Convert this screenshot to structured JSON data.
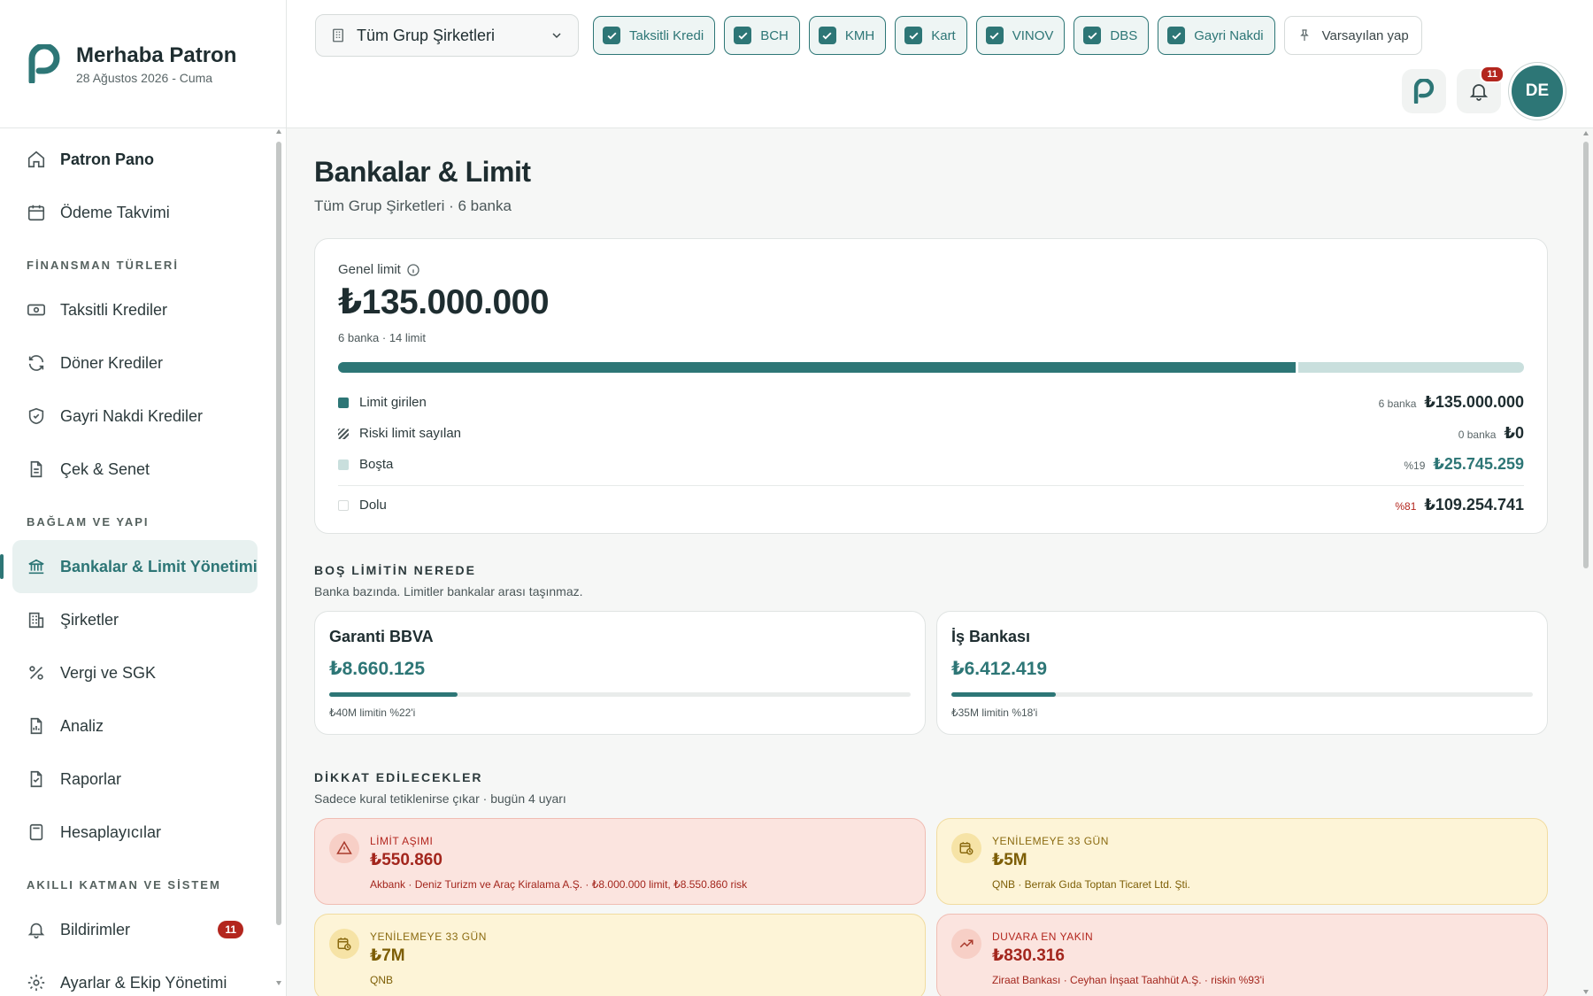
{
  "brand": {
    "name": "Merhaba Patron",
    "date": "28 Ağustos 2026 - Cuma"
  },
  "sidebar": {
    "top_items": [
      {
        "label": "Patron Pano",
        "icon": "home-icon"
      },
      {
        "label": "Ödeme Takvimi",
        "icon": "calendar-icon"
      }
    ],
    "sections": [
      {
        "title": "FİNANSMAN TÜRLERİ",
        "items": [
          {
            "label": "Taksitli Krediler",
            "icon": "banknote-icon"
          },
          {
            "label": "Döner Krediler",
            "icon": "refresh-icon"
          },
          {
            "label": "Gayri Nakdi Krediler",
            "icon": "shield-check-icon"
          },
          {
            "label": "Çek & Senet",
            "icon": "document-icon"
          }
        ]
      },
      {
        "title": "BAĞLAM VE YAPI",
        "items": [
          {
            "label": "Bankalar & Limit Yönetimi",
            "icon": "bank-icon",
            "active": true
          },
          {
            "label": "Şirketler",
            "icon": "building-icon"
          },
          {
            "label": "Vergi ve SGK",
            "icon": "percent-icon"
          },
          {
            "label": "Analiz",
            "icon": "chart-file-icon"
          },
          {
            "label": "Raporlar",
            "icon": "report-file-icon"
          },
          {
            "label": "Hesaplayıcılar",
            "icon": "calculator-icon"
          }
        ]
      },
      {
        "title": "AKILLI KATMAN VE SİSTEM",
        "items": [
          {
            "label": "Bildirimler",
            "icon": "bell-icon",
            "badge": "11"
          },
          {
            "label": "Ayarlar & Ekip Yönetimi",
            "icon": "gear-icon"
          }
        ]
      }
    ]
  },
  "topbar": {
    "company_select": "Tüm Grup Şirketleri",
    "filters": [
      "Taksitli Kredi",
      "BCH",
      "KMH",
      "Kart",
      "VINOV",
      "DBS",
      "Gayri Nakdi"
    ],
    "default_button": "Varsayılan yap",
    "notification_count": "11",
    "avatar_initials": "DE"
  },
  "page": {
    "title": "Bankalar & Limit",
    "subtitle": "Tüm Grup Şirketleri · 6 banka"
  },
  "overview": {
    "label": "Genel limit",
    "total": "₺135.000.000",
    "meta": "6 banka · 14 limit",
    "used_fraction": 0.81,
    "legend": [
      {
        "label": "Limit girilen",
        "note": "6 banka",
        "amount": "₺135.000.000"
      },
      {
        "label": "Riski limit sayılan",
        "note": "0 banka",
        "amount": "₺0"
      },
      {
        "label": "Boşta",
        "note": "%19",
        "amount": "₺25.745.259"
      },
      {
        "label": "Dolu",
        "note": "%81",
        "amount": "₺109.254.741"
      }
    ]
  },
  "free_limit": {
    "title": "BOŞ LİMİTİN NEREDE",
    "subtitle": "Banka bazında. Limitler bankalar arası taşınmaz.",
    "banks": [
      {
        "name": "Garanti BBVA",
        "amount": "₺8.660.125",
        "fraction": 0.22,
        "meta": "₺40M limitin %22'i"
      },
      {
        "name": "İş Bankası",
        "amount": "₺6.412.419",
        "fraction": 0.18,
        "meta": "₺35M limitin %18'i"
      }
    ]
  },
  "attention": {
    "title": "DİKKAT EDİLECEKLER",
    "subtitle": "Sadece kural tetiklenirse çıkar · bugün 4 uyarı",
    "alerts": [
      {
        "kicker": "LİMİT AŞIMI",
        "amount": "₺550.860",
        "desc": "Akbank · Deniz Turizm ve Araç Kiralama A.Ş. · ₺8.000.000 limit, ₺8.550.860 risk",
        "tone": "red",
        "icon": "warning-icon"
      },
      {
        "kicker": "YENİLEMEYE 33 GÜN",
        "amount": "₺5M",
        "desc": "QNB · Berrak Gıda Toptan Ticaret Ltd. Şti.",
        "tone": "yellow",
        "icon": "calendar-clock-icon"
      },
      {
        "kicker": "YENİLEMEYE 33 GÜN",
        "amount": "₺7M",
        "desc": "QNB",
        "tone": "yellow",
        "icon": "calendar-clock-icon"
      },
      {
        "kicker": "DUVARA EN YAKIN",
        "amount": "₺830.316",
        "desc": "Ziraat Bankası · Ceyhan İnşaat Taahhüt A.Ş. · riskin %93'i",
        "tone": "red",
        "icon": "trend-up-icon"
      }
    ]
  },
  "colors": {
    "accent": "#2d7676",
    "danger": "#b3261e",
    "warning": "#8a6a10"
  }
}
